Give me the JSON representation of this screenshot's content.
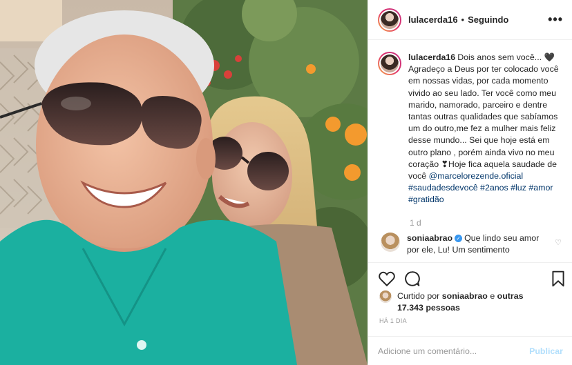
{
  "post": {
    "username": "lulacerda16",
    "dot": "•",
    "follow_status": "Seguindo",
    "more_label": "•••"
  },
  "caption": {
    "username": "lulacerda16",
    "text_start": "Dois anos sem você... 🖤 Agradeço a Deus por ter colocado você em nossas vidas, por cada momento vivido ao seu lado. Ter você como meu marido, namorado, parceiro e dentre tantas outras qualidades que sabíamos um do outro,me fez a mulher mais feliz desse mundo... Sei que hoje está em outro plano , porém ainda vivo no meu coração ❣Hoje fica aquela saudade de você ",
    "mention": "@marcelorezende.oficial",
    "hashtags": [
      "#saudadesdevocê",
      "#2anos",
      "#luz",
      "#amor",
      "#gratidão"
    ],
    "time": "1 d"
  },
  "comment": {
    "username": "soniaabrao",
    "text": "Que lindo seu amor por ele, Lu! Um sentimento"
  },
  "likes": {
    "prefix": "Curtido por",
    "user": "soniaabrao",
    "and": "e",
    "others": "outras 17.343 pessoas"
  },
  "posted_time": "HÁ 1 DIA",
  "add_comment": {
    "placeholder": "Adicione um comentário...",
    "publish_label": "Publicar"
  },
  "colors": {
    "link": "#003569",
    "publish_disabled": "#b2dffc",
    "muted": "#999999",
    "shirt": "#1bb0a0"
  },
  "icons": {
    "like": "heart-icon",
    "comment": "comment-icon",
    "save": "bookmark-icon",
    "more": "more-options-icon"
  }
}
